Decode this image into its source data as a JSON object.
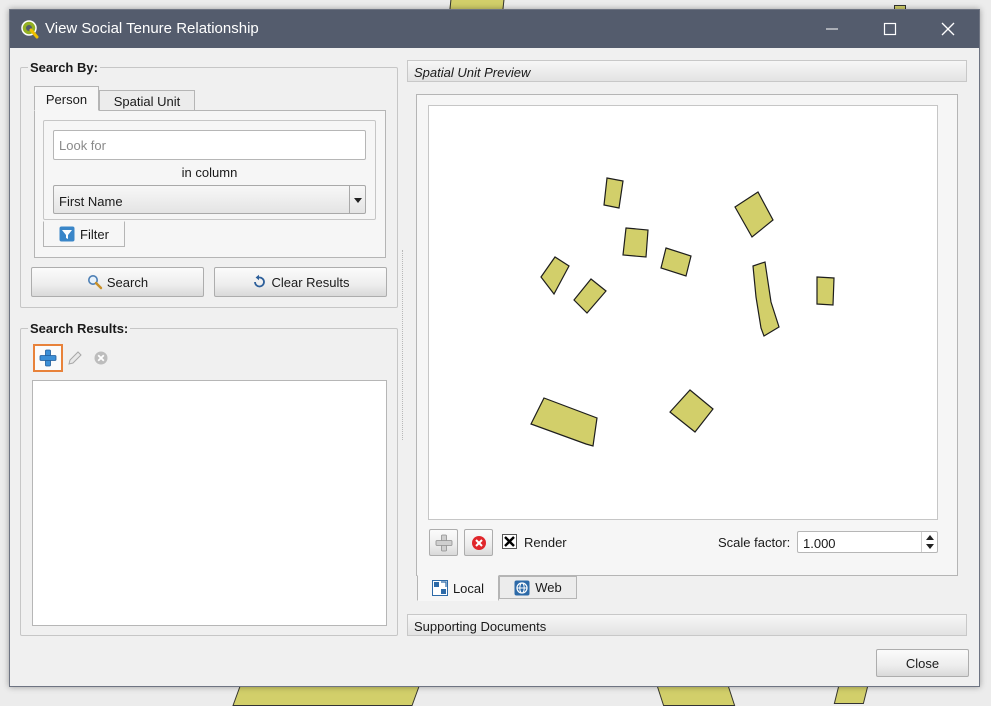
{
  "window": {
    "title": "View Social Tenure Relationship",
    "controls": [
      "minimize",
      "maximize",
      "close"
    ]
  },
  "search_by": {
    "title": "Search By:",
    "tabs": [
      {
        "label": "Person",
        "active": true
      },
      {
        "label": "Spatial Unit",
        "active": false
      }
    ],
    "look_for_placeholder": "Look for",
    "in_column_label": "in column",
    "column_selected": "First Name",
    "filter_tab_label": "Filter",
    "search_button": "Search",
    "clear_button": "Clear Results"
  },
  "search_results": {
    "title": "Search Results:",
    "toolbar": [
      {
        "icon": "add-icon",
        "enabled": true,
        "highlighted": true
      },
      {
        "icon": "edit-icon",
        "enabled": false
      },
      {
        "icon": "remove-icon",
        "enabled": false
      }
    ]
  },
  "preview": {
    "title": "Spatial Unit Preview",
    "render_label": "Render",
    "render_checked": true,
    "scale_label": "Scale factor:",
    "scale_value": "1.000",
    "tabs": [
      {
        "label": "Local",
        "active": true
      },
      {
        "label": "Web",
        "active": false
      }
    ]
  },
  "supporting_documents": {
    "title": "Supporting Documents"
  },
  "close_button": "Close",
  "colors": {
    "titlebar": "#545c6d",
    "parcel_fill": "#d2cf6a",
    "highlight": "#e8823a",
    "remove_red": "#e0262b"
  }
}
